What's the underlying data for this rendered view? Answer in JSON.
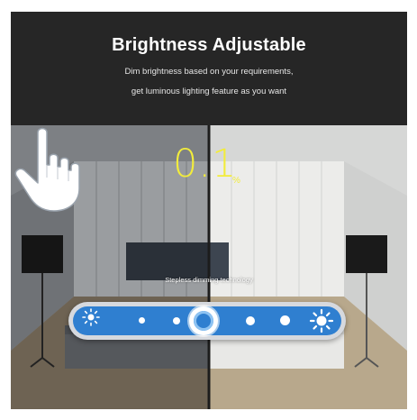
{
  "header": {
    "title": "Brightness Adjustable",
    "subtitle_line1": "Dim brightness based on your requirements,",
    "subtitle_line2": "get luminous lighting feature as you want"
  },
  "display": {
    "value": "0.1",
    "unit": "%"
  },
  "caption": "Stepless dimming technology",
  "slider": {
    "level_fraction": 0.5,
    "min_icon": "sun-small-icon",
    "max_icon": "sun-large-icon"
  },
  "colors": {
    "header_bg": "#262626",
    "value_color": "#f2ec3c",
    "slider_fill": "#2f7fd0"
  }
}
